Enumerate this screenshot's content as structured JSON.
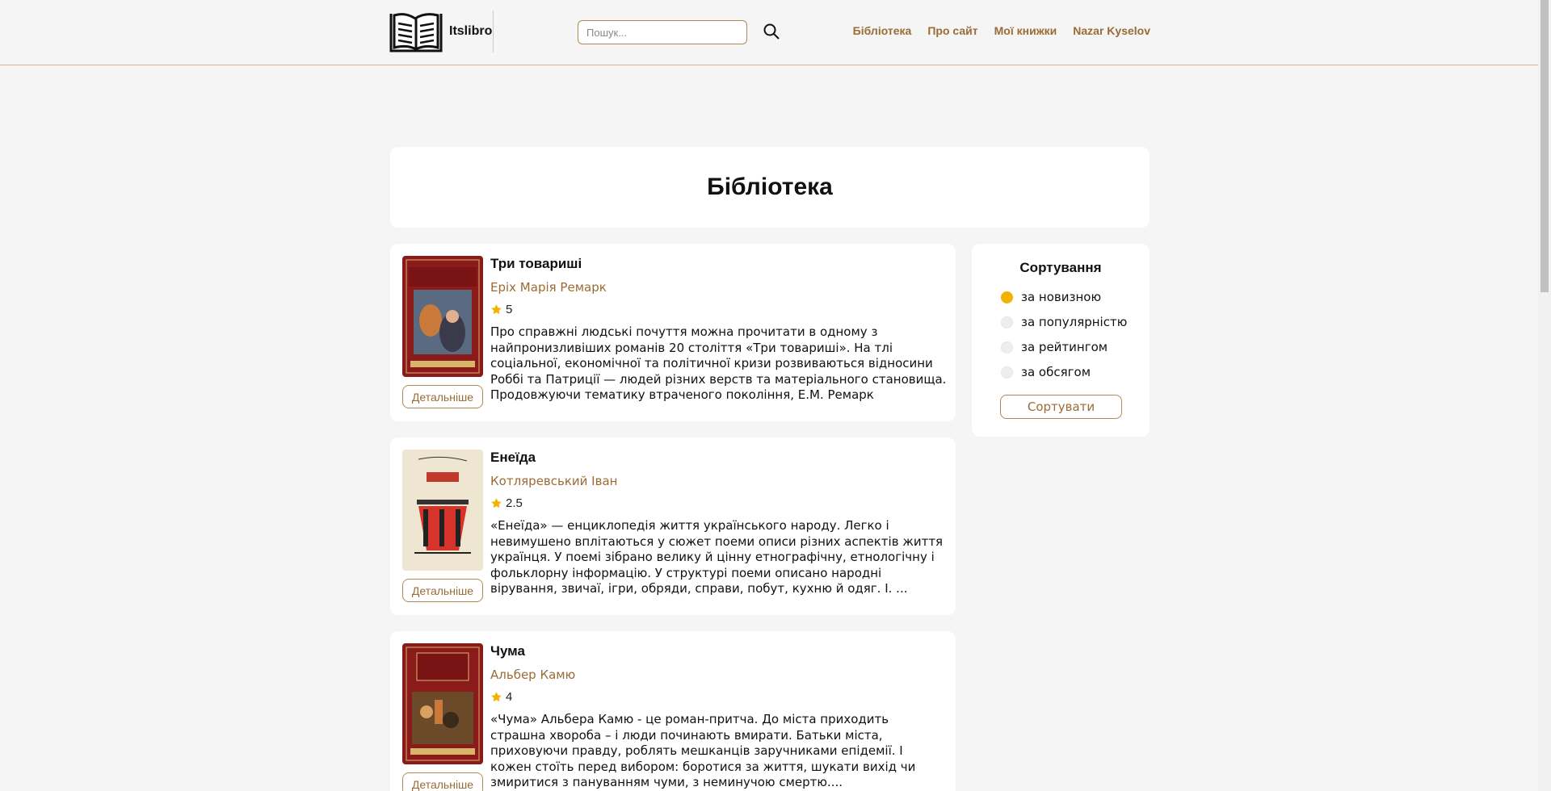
{
  "header": {
    "logo_text": "Itslibro",
    "search_placeholder": "Пошук...",
    "nav": [
      "Бібліотека",
      "Про сайт",
      "Мої книжки",
      "Nazar Kyselov"
    ]
  },
  "page_title": "Бібліотека",
  "books": [
    {
      "title": "Три товариші",
      "author": "Еріх Марія Ремарк",
      "rating": "5",
      "description": "Про справжні людські почуття можна прочитати в одному з найпронизливіших романів 20 століття «Три товариші». На тлі соціальної, економічної та політичної кризи розвиваються відносини Роббі та Патриції — людей різних верств та матеріального становища. Продовжуючи тематику втраченого покоління, Е.М. Ремарк торкається ...",
      "details_label": "Детальніше",
      "cover_color": "#8b1a1a"
    },
    {
      "title": "Енеїда",
      "author": "Котляревський Іван",
      "rating": "2.5",
      "description": "«Енеїда» — енциклопедія життя українського народу. Легко і невимушено вплітаються у сюжет поеми описи різних аспектів життя українця. У поемі зібрано велику й цінну етнографічну, етнологічну і фольклорну інформацію. У структурі поеми описано народні вірування, звичаї, ігри, обряди, справи, побут, кухню й одяг. І. ...",
      "details_label": "Детальніше",
      "cover_color": "#efe6d2"
    },
    {
      "title": "Чума",
      "author": "Альбер Камю",
      "rating": "4",
      "description": "«Чума» Альбера Камю - це роман-притча. До міста приходить страшна хвороба – і люди починають вмирати. Батьки міста, приховуючи правду, роблять мешканців заручниками епідемії. І кожен стоїть перед вибором: боротися за життя, шукати вихід чи змиритися з пануванням чуми, з неминучою смертю....",
      "details_label": "Детальніше",
      "cover_color": "#8b1a1a"
    }
  ],
  "sort": {
    "title": "Сортування",
    "options": [
      "за новизною",
      "за популярністю",
      "за рейтингом",
      "за обсягом"
    ],
    "selected_index": 0,
    "button_label": "Сортувати"
  },
  "colors": {
    "accent": "#9b6b35",
    "star": "#f2b300",
    "background": "#f5f5f5"
  }
}
